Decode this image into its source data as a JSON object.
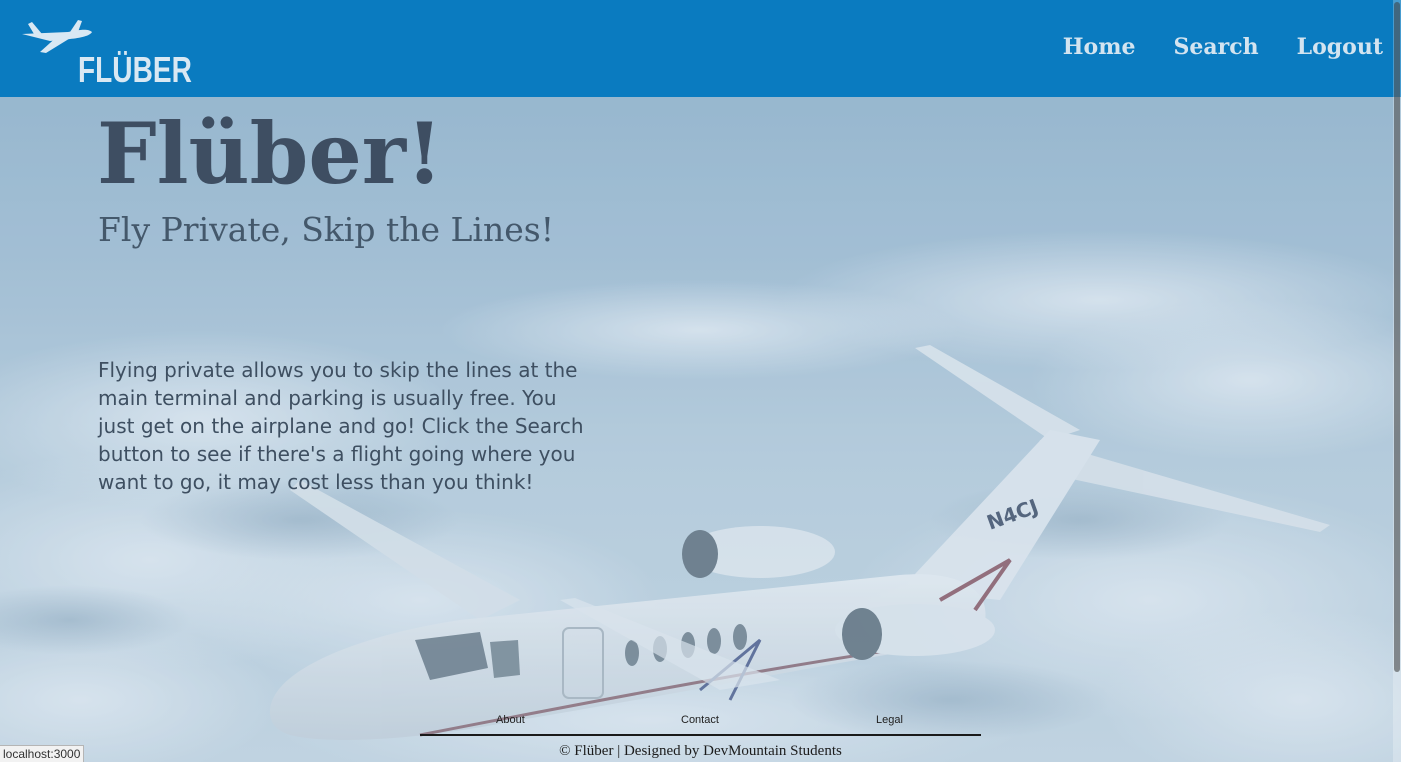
{
  "header": {
    "logo_text": "FLÜBER",
    "nav": [
      {
        "label": "Home"
      },
      {
        "label": "Search"
      },
      {
        "label": "Logout"
      }
    ]
  },
  "hero": {
    "title": "Flüber!",
    "subtitle": "Fly Private, Skip the Lines!",
    "body": "Flying private allows you to skip the lines at the main terminal and parking is usually free. You just get on the airplane and go! Click the Search button to see if there's a flight going where you want to go, it may cost less than you think!",
    "aircraft_tail_number": "N4CJ"
  },
  "footer": {
    "links": [
      {
        "label": "About"
      },
      {
        "label": "Contact"
      },
      {
        "label": "Legal"
      }
    ],
    "copyright": "© Flüber | Designed by DevMountain Students"
  },
  "status_bar": {
    "url": "localhost:3000"
  },
  "colors": {
    "header_bg": "#0a7bc0",
    "sky": "#8fb3cc",
    "title_text": "#3e4e62"
  }
}
